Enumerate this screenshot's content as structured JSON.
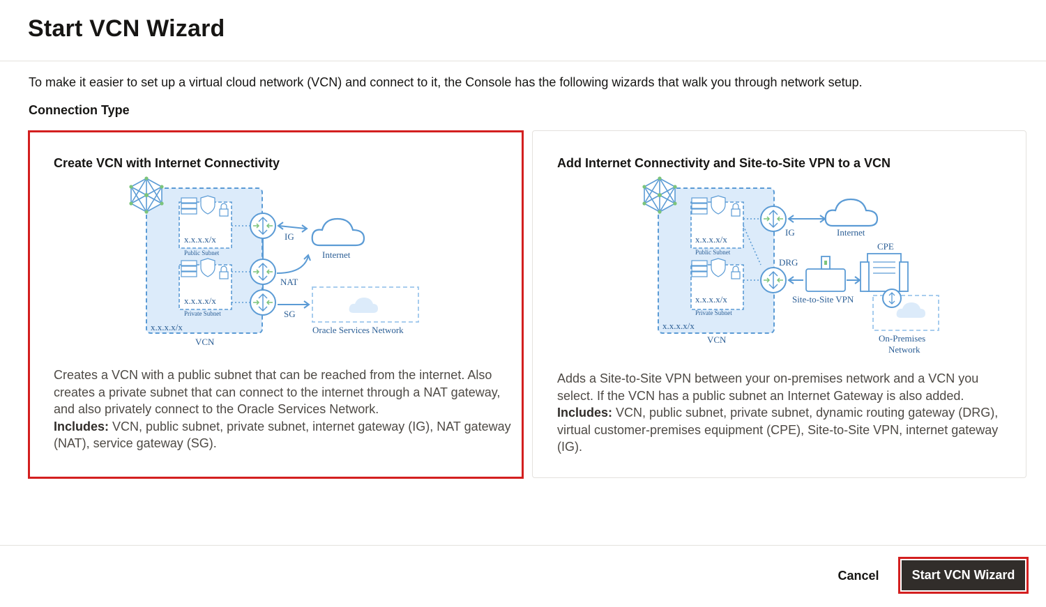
{
  "page": {
    "title": "Start VCN Wizard",
    "intro": "To make it easier to set up a virtual cloud network (VCN) and connect to it, the Console has the following wizards that walk you through network setup.",
    "section_label": "Connection Type"
  },
  "cards": [
    {
      "title": "Create VCN with Internet Connectivity",
      "selected": true,
      "desc_line1": "Creates a VCN with a public subnet that can be reached from the internet. Also",
      "desc_line2": "creates a private subnet that can connect to the internet through a NAT gateway,",
      "desc_line3": "and also privately connect to the Oracle Services Network.",
      "includes_label": "Includes:",
      "includes_line1": " VCN, public subnet, private subnet, internet gateway (IG), NAT gateway",
      "includes_line2": "(NAT), service gateway (SG).",
      "diagram": {
        "cidr_1": "x.x.x.x/x",
        "public_subnet": "Public Subnet",
        "cidr_2": "x.x.x.x/x",
        "private_subnet": "Private Subnet",
        "vcn_cidr": "x.x.x.x/x",
        "vcn": "VCN",
        "ig": "IG",
        "nat": "NAT",
        "sg": "SG",
        "internet": "Internet",
        "osn": "Oracle Services Network"
      }
    },
    {
      "title": "Add Internet Connectivity and Site-to-Site VPN to a VCN",
      "selected": false,
      "desc_line1": "Adds a Site-to-Site VPN between your on-premises network and a VCN you",
      "desc_line2": "select. If the VCN has a public subnet an Internet Gateway is also added.",
      "includes_label": "Includes:",
      "includes_line1": " VCN, public subnet, private subnet, dynamic routing gateway (DRG),",
      "includes_line2": "virtual customer-premises equipment (CPE), Site-to-Site VPN, internet gateway",
      "includes_line3": "(IG).",
      "diagram": {
        "cidr_1": "x.x.x.x/x",
        "public_subnet": "Public Subnet",
        "cidr_2": "x.x.x.x/x",
        "private_subnet": "Private Subnet",
        "vcn_cidr": "x.x.x.x/x",
        "vcn": "VCN",
        "ig": "IG",
        "drg": "DRG",
        "internet": "Internet",
        "cpe": "CPE",
        "vpn": "Site-to-Site VPN",
        "onprem_1": "On-Premises",
        "onprem_2": "Network"
      }
    }
  ],
  "footer": {
    "cancel_label": "Cancel",
    "primary_label": "Start VCN Wizard"
  },
  "colors": {
    "selected_border": "#d31f1f",
    "diagram_blue": "#5b9bd5",
    "diagram_fill": "#dcebfa",
    "primary_button": "#312d2a"
  }
}
